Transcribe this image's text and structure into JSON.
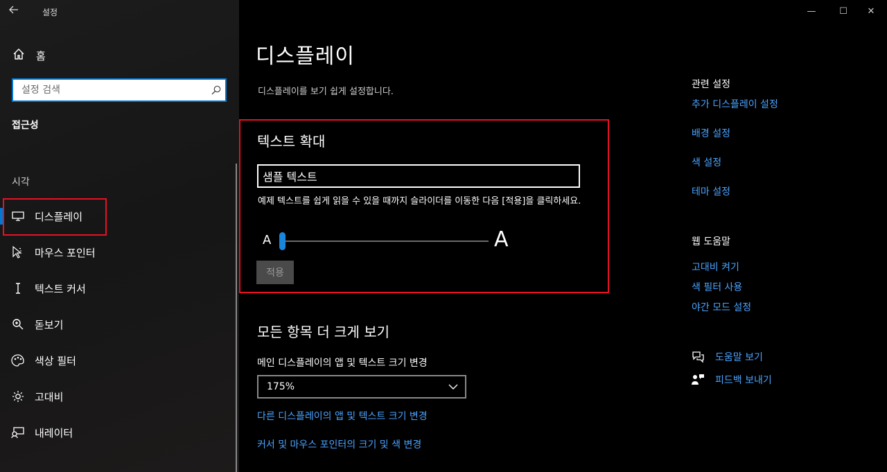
{
  "window": {
    "title": "설정",
    "minimize": "—",
    "maximize": "☐",
    "close": "✕"
  },
  "sidebar": {
    "home_label": "홈",
    "search_placeholder": "설정 검색",
    "section_title": "접근성",
    "group_title": "시각",
    "items": [
      {
        "label": "디스플레이",
        "icon": "monitor-icon",
        "active": true
      },
      {
        "label": "마우스 포인터",
        "icon": "mouse-pointer-icon"
      },
      {
        "label": "텍스트 커서",
        "icon": "text-cursor-icon"
      },
      {
        "label": "돋보기",
        "icon": "magnifier-icon"
      },
      {
        "label": "색상 필터",
        "icon": "palette-icon"
      },
      {
        "label": "고대비",
        "icon": "sun-icon"
      },
      {
        "label": "내레이터",
        "icon": "narrator-icon"
      }
    ]
  },
  "main": {
    "title": "디스플레이",
    "description": "디스플레이를 보기 쉽게 설정합니다.",
    "text_size": {
      "heading": "텍스트 확대",
      "sample_text": "샘플 텍스트",
      "instruction": "예제 텍스트를 쉽게 읽을 수 있을 때까지 슬라이더를 이동한 다음 [적용]을 클릭하세요.",
      "slider_min_label": "A",
      "slider_max_label": "A",
      "slider_value": 0,
      "apply_label": "적용"
    },
    "make_bigger": {
      "heading": "모든 항목 더 크게 보기",
      "scale_label": "메인 디스플레이의 앱 및 텍스트 크기 변경",
      "scale_value": "175%",
      "other_display_link": "다른 디스플레이의 앱 및 텍스트 크기 변경",
      "cursor_link": "커서 및 마우스 포인터의 크기 및 색 변경"
    }
  },
  "related": {
    "title": "관련 설정",
    "links": [
      "추가 디스플레이 설정",
      "배경 설정",
      "색 설정",
      "테마 설정"
    ]
  },
  "web_help": {
    "title": "웹 도움말",
    "links": [
      "고대비 켜기",
      "색 필터 사용",
      "야간 모드 설정"
    ]
  },
  "help": {
    "get_help": "도움말 보기",
    "feedback": "피드백 보내기"
  },
  "colors": {
    "accent": "#0078d4",
    "link": "#4aa3ff",
    "highlight_box": "#e81123"
  }
}
